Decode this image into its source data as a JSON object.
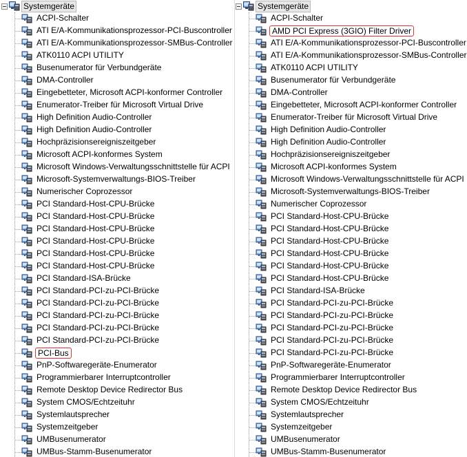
{
  "left_tree": {
    "root_label": "Systemgeräte",
    "items": [
      {
        "label": "ACPI-Schalter",
        "highlighted": false
      },
      {
        "label": "ATI E/A-Kommunikationsprozessor-PCI-Buscontroller",
        "highlighted": false
      },
      {
        "label": "ATI E/A-Kommunikationsprozessor-SMBus-Controller",
        "highlighted": false
      },
      {
        "label": "ATK0110 ACPI UTILITY",
        "highlighted": false
      },
      {
        "label": "Busenumerator für Verbundgeräte",
        "highlighted": false
      },
      {
        "label": "DMA-Controller",
        "highlighted": false
      },
      {
        "label": "Eingebetteter, Microsoft ACPI-konformer Controller",
        "highlighted": false
      },
      {
        "label": "Enumerator-Treiber für Microsoft Virtual Drive",
        "highlighted": false
      },
      {
        "label": "High Definition Audio-Controller",
        "highlighted": false
      },
      {
        "label": "High Definition Audio-Controller",
        "highlighted": false
      },
      {
        "label": "Hochpräzisionsereigniszeitgeber",
        "highlighted": false
      },
      {
        "label": "Microsoft ACPI-konformes System",
        "highlighted": false
      },
      {
        "label": "Microsoft Windows-Verwaltungsschnittstelle für ACPI",
        "highlighted": false
      },
      {
        "label": "Microsoft-Systemverwaltungs-BIOS-Treiber",
        "highlighted": false
      },
      {
        "label": "Numerischer Coprozessor",
        "highlighted": false
      },
      {
        "label": "PCI Standard-Host-CPU-Brücke",
        "highlighted": false
      },
      {
        "label": "PCI Standard-Host-CPU-Brücke",
        "highlighted": false
      },
      {
        "label": "PCI Standard-Host-CPU-Brücke",
        "highlighted": false
      },
      {
        "label": "PCI Standard-Host-CPU-Brücke",
        "highlighted": false
      },
      {
        "label": "PCI Standard-Host-CPU-Brücke",
        "highlighted": false
      },
      {
        "label": "PCI Standard-Host-CPU-Brücke",
        "highlighted": false
      },
      {
        "label": "PCI Standard-ISA-Brücke",
        "highlighted": false
      },
      {
        "label": "PCI Standard-PCI-zu-PCI-Brücke",
        "highlighted": false
      },
      {
        "label": "PCI Standard-PCI-zu-PCI-Brücke",
        "highlighted": false
      },
      {
        "label": "PCI Standard-PCI-zu-PCI-Brücke",
        "highlighted": false
      },
      {
        "label": "PCI Standard-PCI-zu-PCI-Brücke",
        "highlighted": false
      },
      {
        "label": "PCI Standard-PCI-zu-PCI-Brücke",
        "highlighted": false
      },
      {
        "label": "PCI-Bus",
        "highlighted": true
      },
      {
        "label": "PnP-Softwaregeräte-Enumerator",
        "highlighted": false
      },
      {
        "label": "Programmierbarer Interruptcontroller",
        "highlighted": false
      },
      {
        "label": "Remote Desktop Device Redirector Bus",
        "highlighted": false
      },
      {
        "label": "System CMOS/Echtzeituhr",
        "highlighted": false
      },
      {
        "label": "Systemlautsprecher",
        "highlighted": false
      },
      {
        "label": "Systemzeitgeber",
        "highlighted": false
      },
      {
        "label": "UMBusenumerator",
        "highlighted": false
      },
      {
        "label": "UMBus-Stamm-Busenumerator",
        "highlighted": false
      }
    ]
  },
  "right_tree": {
    "root_label": "Systemgeräte",
    "items": [
      {
        "label": "ACPI-Schalter",
        "highlighted": false
      },
      {
        "label": "AMD PCI Express (3GIO) Filter Driver",
        "highlighted": true
      },
      {
        "label": "ATI E/A-Kommunikationsprozessor-PCI-Buscontroller",
        "highlighted": false
      },
      {
        "label": "ATI E/A-Kommunikationsprozessor-SMBus-Controller",
        "highlighted": false
      },
      {
        "label": "ATK0110 ACPI UTILITY",
        "highlighted": false
      },
      {
        "label": "Busenumerator für Verbundgeräte",
        "highlighted": false
      },
      {
        "label": "DMA-Controller",
        "highlighted": false
      },
      {
        "label": "Eingebetteter, Microsoft ACPI-konformer Controller",
        "highlighted": false
      },
      {
        "label": "Enumerator-Treiber für Microsoft Virtual Drive",
        "highlighted": false
      },
      {
        "label": "High Definition Audio-Controller",
        "highlighted": false
      },
      {
        "label": "High Definition Audio-Controller",
        "highlighted": false
      },
      {
        "label": "Hochpräzisionsereigniszeitgeber",
        "highlighted": false
      },
      {
        "label": "Microsoft ACPI-konformes System",
        "highlighted": false
      },
      {
        "label": "Microsoft Windows-Verwaltungsschnittstelle für ACPI",
        "highlighted": false
      },
      {
        "label": "Microsoft-Systemverwaltungs-BIOS-Treiber",
        "highlighted": false
      },
      {
        "label": "Numerischer Coprozessor",
        "highlighted": false
      },
      {
        "label": "PCI Standard-Host-CPU-Brücke",
        "highlighted": false
      },
      {
        "label": "PCI Standard-Host-CPU-Brücke",
        "highlighted": false
      },
      {
        "label": "PCI Standard-Host-CPU-Brücke",
        "highlighted": false
      },
      {
        "label": "PCI Standard-Host-CPU-Brücke",
        "highlighted": false
      },
      {
        "label": "PCI Standard-Host-CPU-Brücke",
        "highlighted": false
      },
      {
        "label": "PCI Standard-Host-CPU-Brücke",
        "highlighted": false
      },
      {
        "label": "PCI Standard-ISA-Brücke",
        "highlighted": false
      },
      {
        "label": "PCI Standard-PCI-zu-PCI-Brücke",
        "highlighted": false
      },
      {
        "label": "PCI Standard-PCI-zu-PCI-Brücke",
        "highlighted": false
      },
      {
        "label": "PCI Standard-PCI-zu-PCI-Brücke",
        "highlighted": false
      },
      {
        "label": "PCI Standard-PCI-zu-PCI-Brücke",
        "highlighted": false
      },
      {
        "label": "PCI Standard-PCI-zu-PCI-Brücke",
        "highlighted": false
      },
      {
        "label": "PnP-Softwaregeräte-Enumerator",
        "highlighted": false
      },
      {
        "label": "Programmierbarer Interruptcontroller",
        "highlighted": false
      },
      {
        "label": "Remote Desktop Device Redirector Bus",
        "highlighted": false
      },
      {
        "label": "System CMOS/Echtzeituhr",
        "highlighted": false
      },
      {
        "label": "Systemlautsprecher",
        "highlighted": false
      },
      {
        "label": "Systemzeitgeber",
        "highlighted": false
      },
      {
        "label": "UMBusenumerator",
        "highlighted": false
      },
      {
        "label": "UMBus-Stamm-Busenumerator",
        "highlighted": false
      }
    ]
  },
  "colors": {
    "highlight_border": "#e03030",
    "tree_line": "#a0a0a0",
    "root_selection_bg": "#e8e8e8"
  },
  "icons": {
    "root": "system-devices-icon",
    "item": "system-device-icon"
  }
}
